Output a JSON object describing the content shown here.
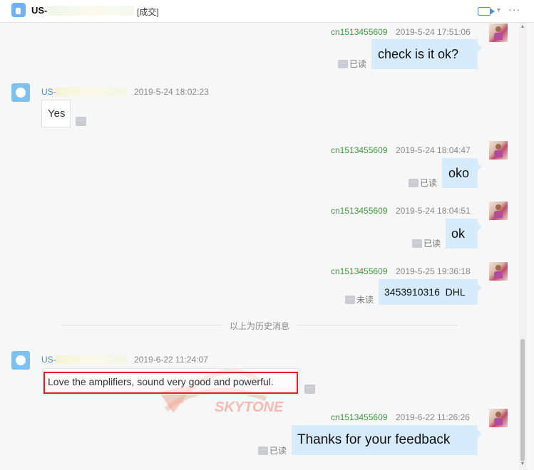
{
  "header": {
    "title": "US-",
    "status": "[成交]",
    "video_icon": "video-camera-icon",
    "more_icon": "ellipsis-icon",
    "more_glyph": "···",
    "caret_glyph": "▼"
  },
  "messages": [
    {
      "sender": "cn1513455609",
      "time": "2019-5-24 17:51:06",
      "text": "check is it ok?",
      "receipt": "已读"
    },
    {
      "sender": "US-",
      "time": "2019-5-24 18:02:23",
      "text": "Yes"
    },
    {
      "sender": "cn1513455609",
      "time": "2019-5-24 18:04:47",
      "text": "oko",
      "receipt": "已读"
    },
    {
      "sender": "cn1513455609",
      "time": "2019-5-24 18:04:51",
      "text": "ok",
      "receipt": "已读"
    },
    {
      "sender": "cn1513455609",
      "time": "2019-5-25 19:36:18",
      "text": "3453910316  DHL",
      "receipt": "未读"
    },
    {
      "sender": "US-",
      "time": "2019-6-22 11:24:07",
      "text": "Love the amplifiers, sound very good and powerful."
    },
    {
      "sender": "cn1513455609",
      "time": "2019-6-22 11:26:26",
      "text": "Thanks for your feedback",
      "receipt": "已读"
    }
  ],
  "divider": {
    "text": "以上为历史消息"
  },
  "ui": {
    "more_dots": "···"
  },
  "watermark": {
    "text": "SKYTONE"
  },
  "colors": {
    "sent_bubble": "#d6ebfb",
    "sender_name": "#3a9a3a",
    "contact_name": "#3a8fd8",
    "highlight": "#e02020"
  }
}
